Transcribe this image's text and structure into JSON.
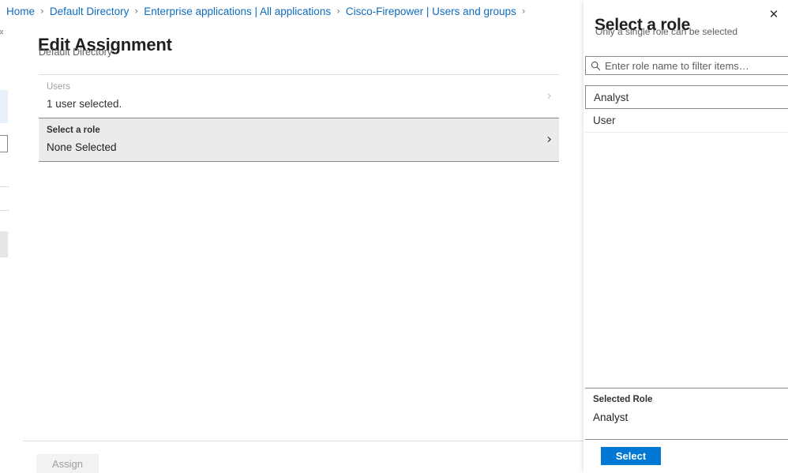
{
  "breadcrumb": {
    "separator": "›",
    "items": [
      {
        "label": "Home"
      },
      {
        "label": "Default Directory"
      },
      {
        "label": "Enterprise applications | All applications"
      },
      {
        "label": "Cisco-Firepower | Users and groups"
      }
    ]
  },
  "blade": {
    "title": "Edit Assignment",
    "subtitle": "Default Directory",
    "rows": [
      {
        "label": "Users",
        "value": "1 user selected.",
        "chevron": "›"
      },
      {
        "label": "Select a role",
        "value": "None Selected",
        "chevron": "›"
      }
    ],
    "assign_label": "Assign"
  },
  "panel": {
    "title": "Select a role",
    "subtitle": "Only a single role can be selected",
    "close_glyph": "✕",
    "search": {
      "placeholder": "Enter role name to filter items…",
      "value": "",
      "icon": "search-icon"
    },
    "roles": [
      {
        "label": "Analyst"
      },
      {
        "label": "User"
      }
    ],
    "selected_role_label": "Selected Role",
    "selected_role_value": "Analyst",
    "select_label": "Select"
  },
  "colors": {
    "accent": "#0078d4",
    "link": "#0f6cbd",
    "active_row_bg": "#ebebeb",
    "border": "#8a8886",
    "muted_text": "#605e5c",
    "disabled_button_bg": "#f3f2f1"
  }
}
